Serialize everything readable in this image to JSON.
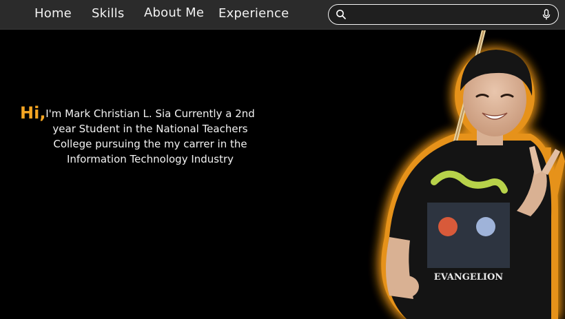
{
  "nav": {
    "home": "Home",
    "skills": "Skills",
    "about": "About Me",
    "experience": "Experience"
  },
  "search": {
    "placeholder": "",
    "value": ""
  },
  "hero": {
    "greeting": "Hi,",
    "intro": "I'm Mark Christian L. Sia Currently a 2nd year Student in the National Teachers College pursuing the my carrer in the Information Technology Industry",
    "shirt_logo_text": "EVANGELION",
    "accent_color": "#f5a623"
  },
  "icons": {
    "search": "search-icon",
    "mic": "microphone-icon"
  }
}
